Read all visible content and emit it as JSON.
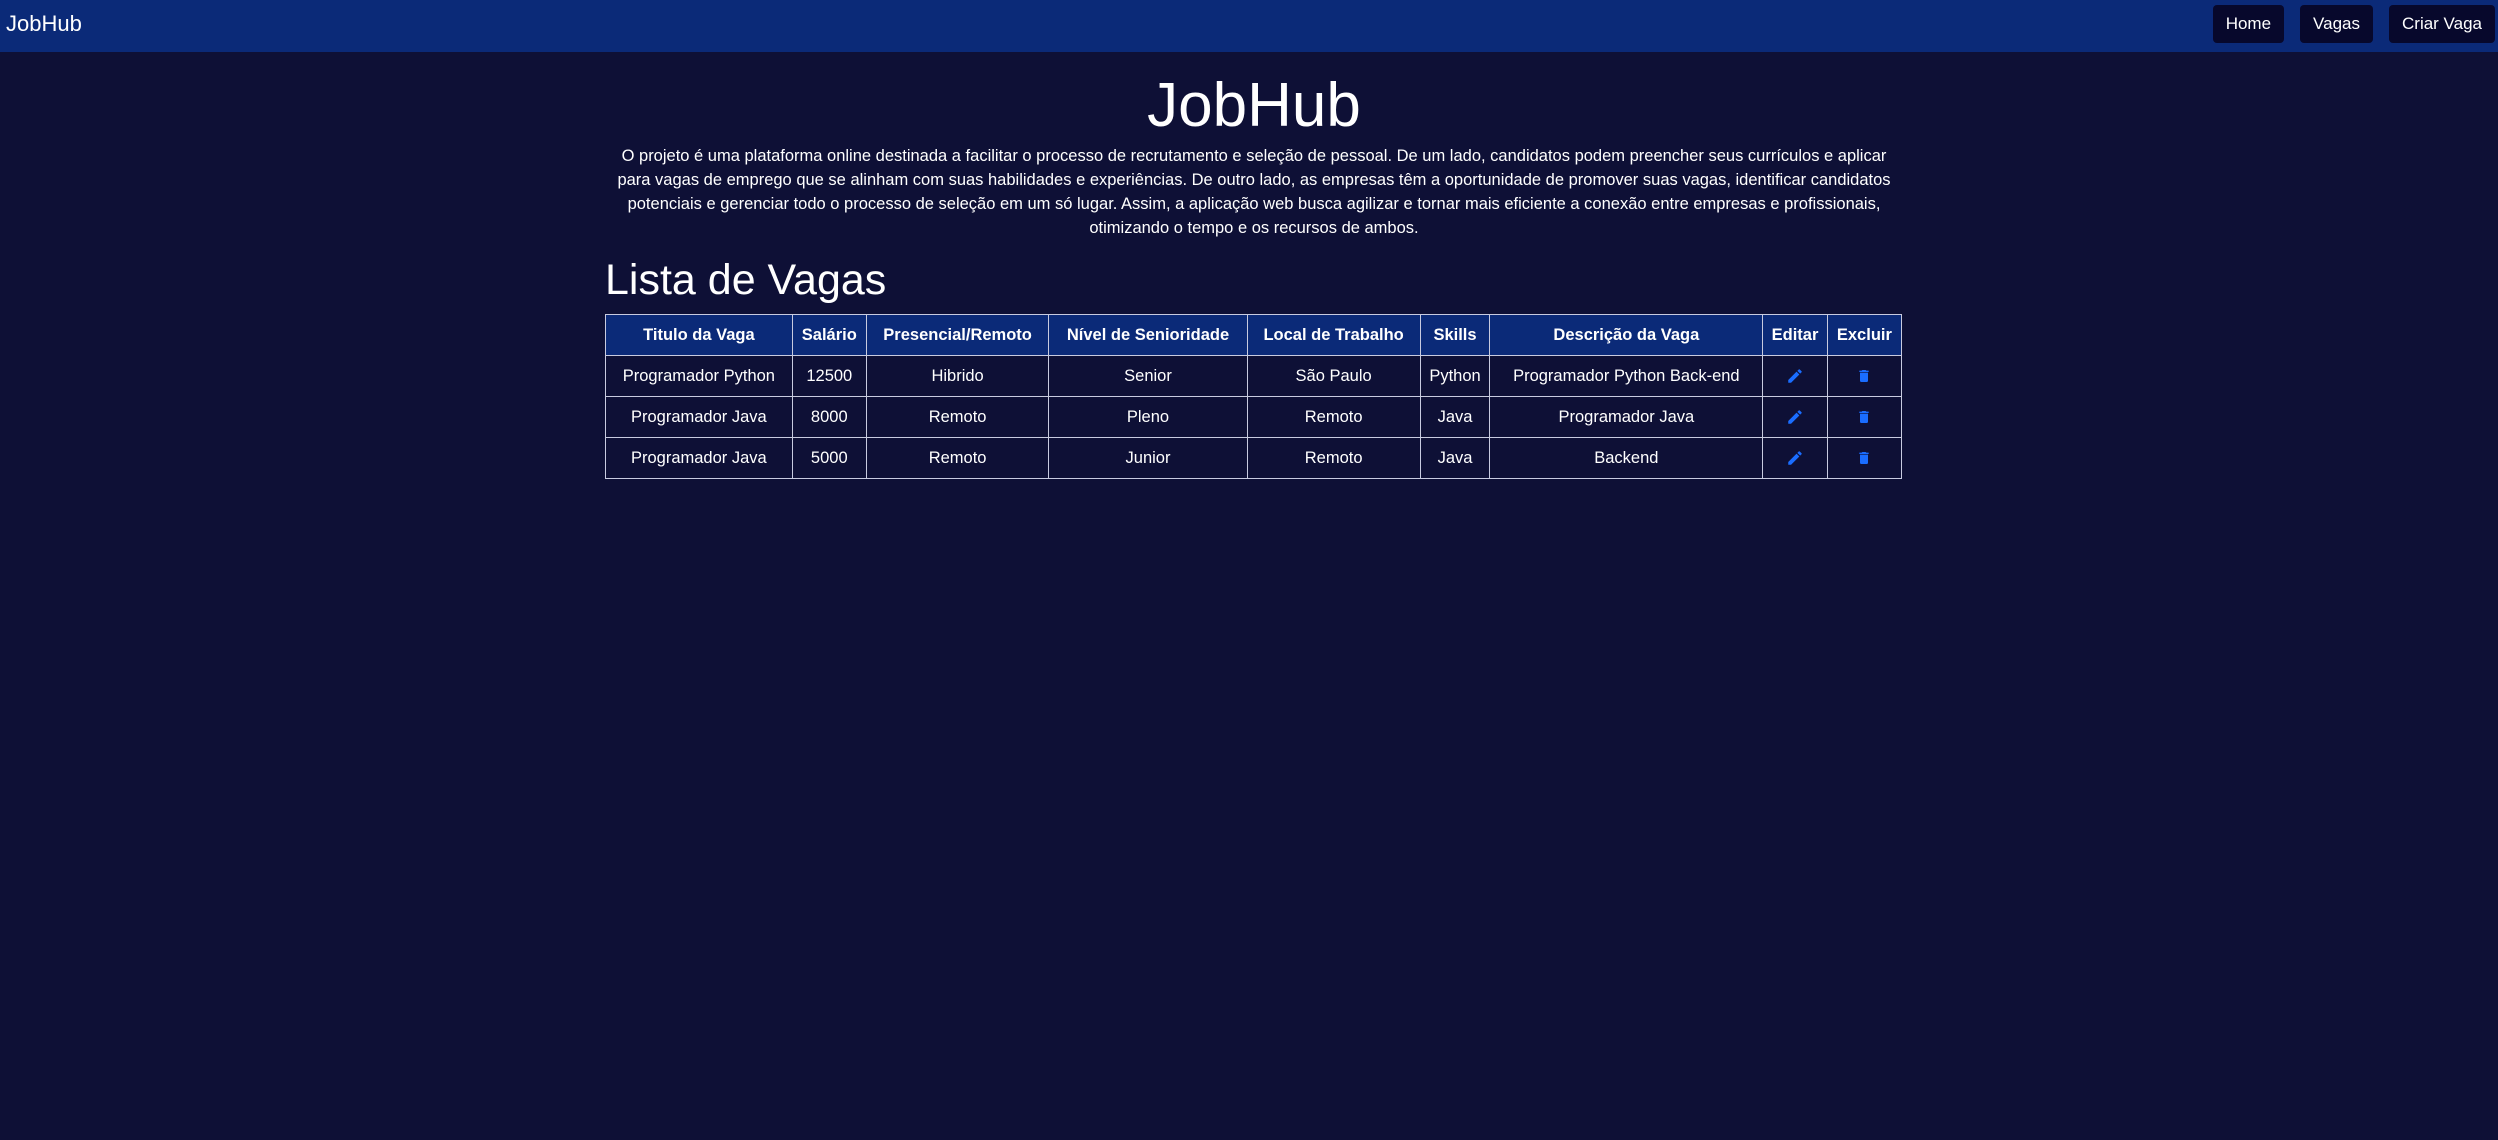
{
  "navbar": {
    "brand": "JobHub",
    "links": [
      "Home",
      "Vagas",
      "Criar Vaga"
    ]
  },
  "hero": {
    "title": "JobHub",
    "description": "O projeto é uma plataforma online destinada a facilitar o processo de recrutamento e seleção de pessoal. De um lado, candidatos podem preencher seus currículos e aplicar para vagas de emprego que se alinham com suas habilidades e experiências. De outro lado, as empresas têm a oportunidade de promover suas vagas, identificar candidatos potenciais e gerenciar todo o processo de seleção em um só lugar. Assim, a aplicação web busca agilizar e tornar mais eficiente a conexão entre empresas e profissionais, otimizando o tempo e os recursos de ambos."
  },
  "jobs": {
    "section_title": "Lista de Vagas",
    "columns": [
      "Titulo da Vaga",
      "Salário",
      "Presencial/Remoto",
      "Nível de Senioridade",
      "Local de Trabalho",
      "Skills",
      "Descrição da Vaga",
      "Editar",
      "Excluir"
    ],
    "rows": [
      [
        "Programador Python",
        "12500",
        "Hibrido",
        "Senior",
        "São Paulo",
        "Python",
        "Programador Python Back-end"
      ],
      [
        "Programador Java",
        "8000",
        "Remoto",
        "Pleno",
        "Remoto",
        "Java",
        "Programador Java"
      ],
      [
        "Programador Java",
        "5000",
        "Remoto",
        "Junior",
        "Remoto",
        "Java",
        "Backend"
      ]
    ],
    "edit_icon": "pencil-icon",
    "delete_icon": "trash-icon",
    "icon_color": "#1a6dff"
  },
  "colors": {
    "background": "#0e1036",
    "navbar": "#0b2a78",
    "nav_button": "#07082c",
    "accent": "#1a6dff"
  }
}
